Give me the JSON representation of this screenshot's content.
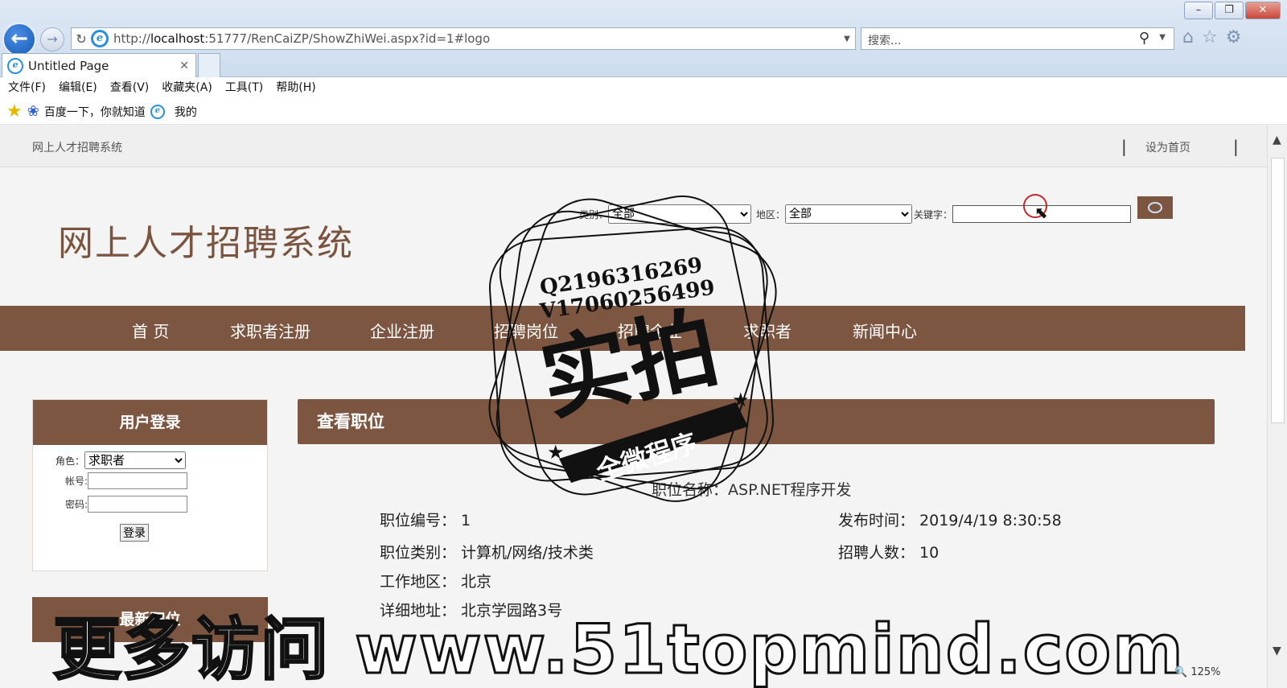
{
  "browser": {
    "url_prefix": "http://",
    "url_host": "localhost",
    "url_rest": ":51777/RenCaiZP/ShowZhiWei.aspx?id=1#logo",
    "search_placeholder": "搜索...",
    "tab_title": "Untitled Page",
    "menu": [
      "文件(F)",
      "编辑(E)",
      "查看(V)",
      "收藏夹(A)",
      "工具(T)",
      "帮助(H)"
    ],
    "favorites": [
      "百度一下，你就知道",
      "我的"
    ],
    "zoom": "125%"
  },
  "site": {
    "top_title": "网上人才招聘系统",
    "set_home": "设为首页",
    "logo_text": "网上人才招聘系统"
  },
  "filters": {
    "category_label": "类别：",
    "category_value": "全部",
    "area_label": "地区：",
    "area_value": "全部",
    "keyword_label": "关键字："
  },
  "nav": [
    "首 页",
    "求职者注册",
    "企业注册",
    "招聘岗位",
    "招聘企业",
    "求职者",
    "新闻中心"
  ],
  "login": {
    "title": "用户登录",
    "role_label": "角色：",
    "role_value": "求职者",
    "account_label": "帐号:",
    "password_label": "密码:",
    "submit": "登录"
  },
  "panel2_title": "最新职位",
  "job": {
    "section_title": "查看职位",
    "name_label": "职位名称：",
    "name_value": "ASP.NET程序开发",
    "fields": [
      {
        "label": "职位编号：",
        "value": "1"
      },
      {
        "label": "发布时间：",
        "value": "2019/4/19 8:30:58"
      },
      {
        "label": "职位类别：",
        "value": "计算机/网络/技术类"
      },
      {
        "label": "招聘人数：",
        "value": "10"
      },
      {
        "label": "工作地区：",
        "value": "北京"
      },
      {
        "label": "详细地址：",
        "value": "北京学园路3号"
      }
    ]
  },
  "watermark": {
    "qq": "Q2196316269",
    "wx": "V17060256499",
    "big": "实拍",
    "ribbon": "全微程序",
    "bottom": "更多访问 www.51topmind.com"
  }
}
